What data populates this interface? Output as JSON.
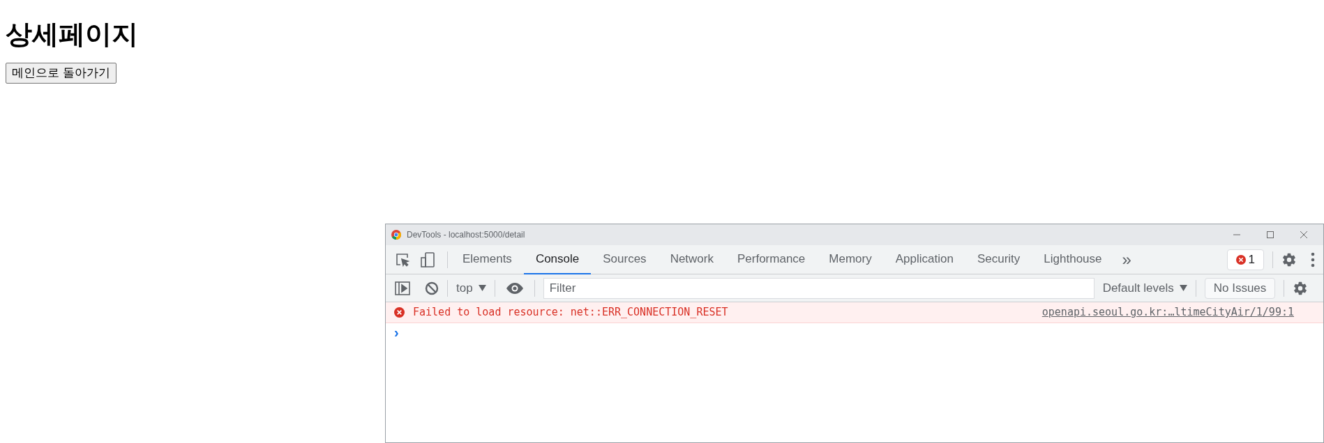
{
  "page": {
    "heading": "상세페이지",
    "back_button": "메인으로 돌아가기"
  },
  "devtools": {
    "title": "DevTools - localhost:5000/detail",
    "tabs": [
      {
        "label": "Elements",
        "selected": false
      },
      {
        "label": "Console",
        "selected": true
      },
      {
        "label": "Sources",
        "selected": false
      },
      {
        "label": "Network",
        "selected": false
      },
      {
        "label": "Performance",
        "selected": false
      },
      {
        "label": "Memory",
        "selected": false
      },
      {
        "label": "Application",
        "selected": false
      },
      {
        "label": "Security",
        "selected": false
      },
      {
        "label": "Lighthouse",
        "selected": false
      }
    ],
    "more_tabs": "»",
    "error_count": "1",
    "toolbar": {
      "context": "top",
      "filter_placeholder": "Filter",
      "levels": "Default levels",
      "issues": "No Issues"
    },
    "messages": [
      {
        "kind": "error",
        "text": "Failed to load resource: net::ERR_CONNECTION_RESET",
        "source": "openapi.seoul.go.kr:…ltimeCityAir/1/99:1"
      }
    ],
    "prompt": "›"
  }
}
